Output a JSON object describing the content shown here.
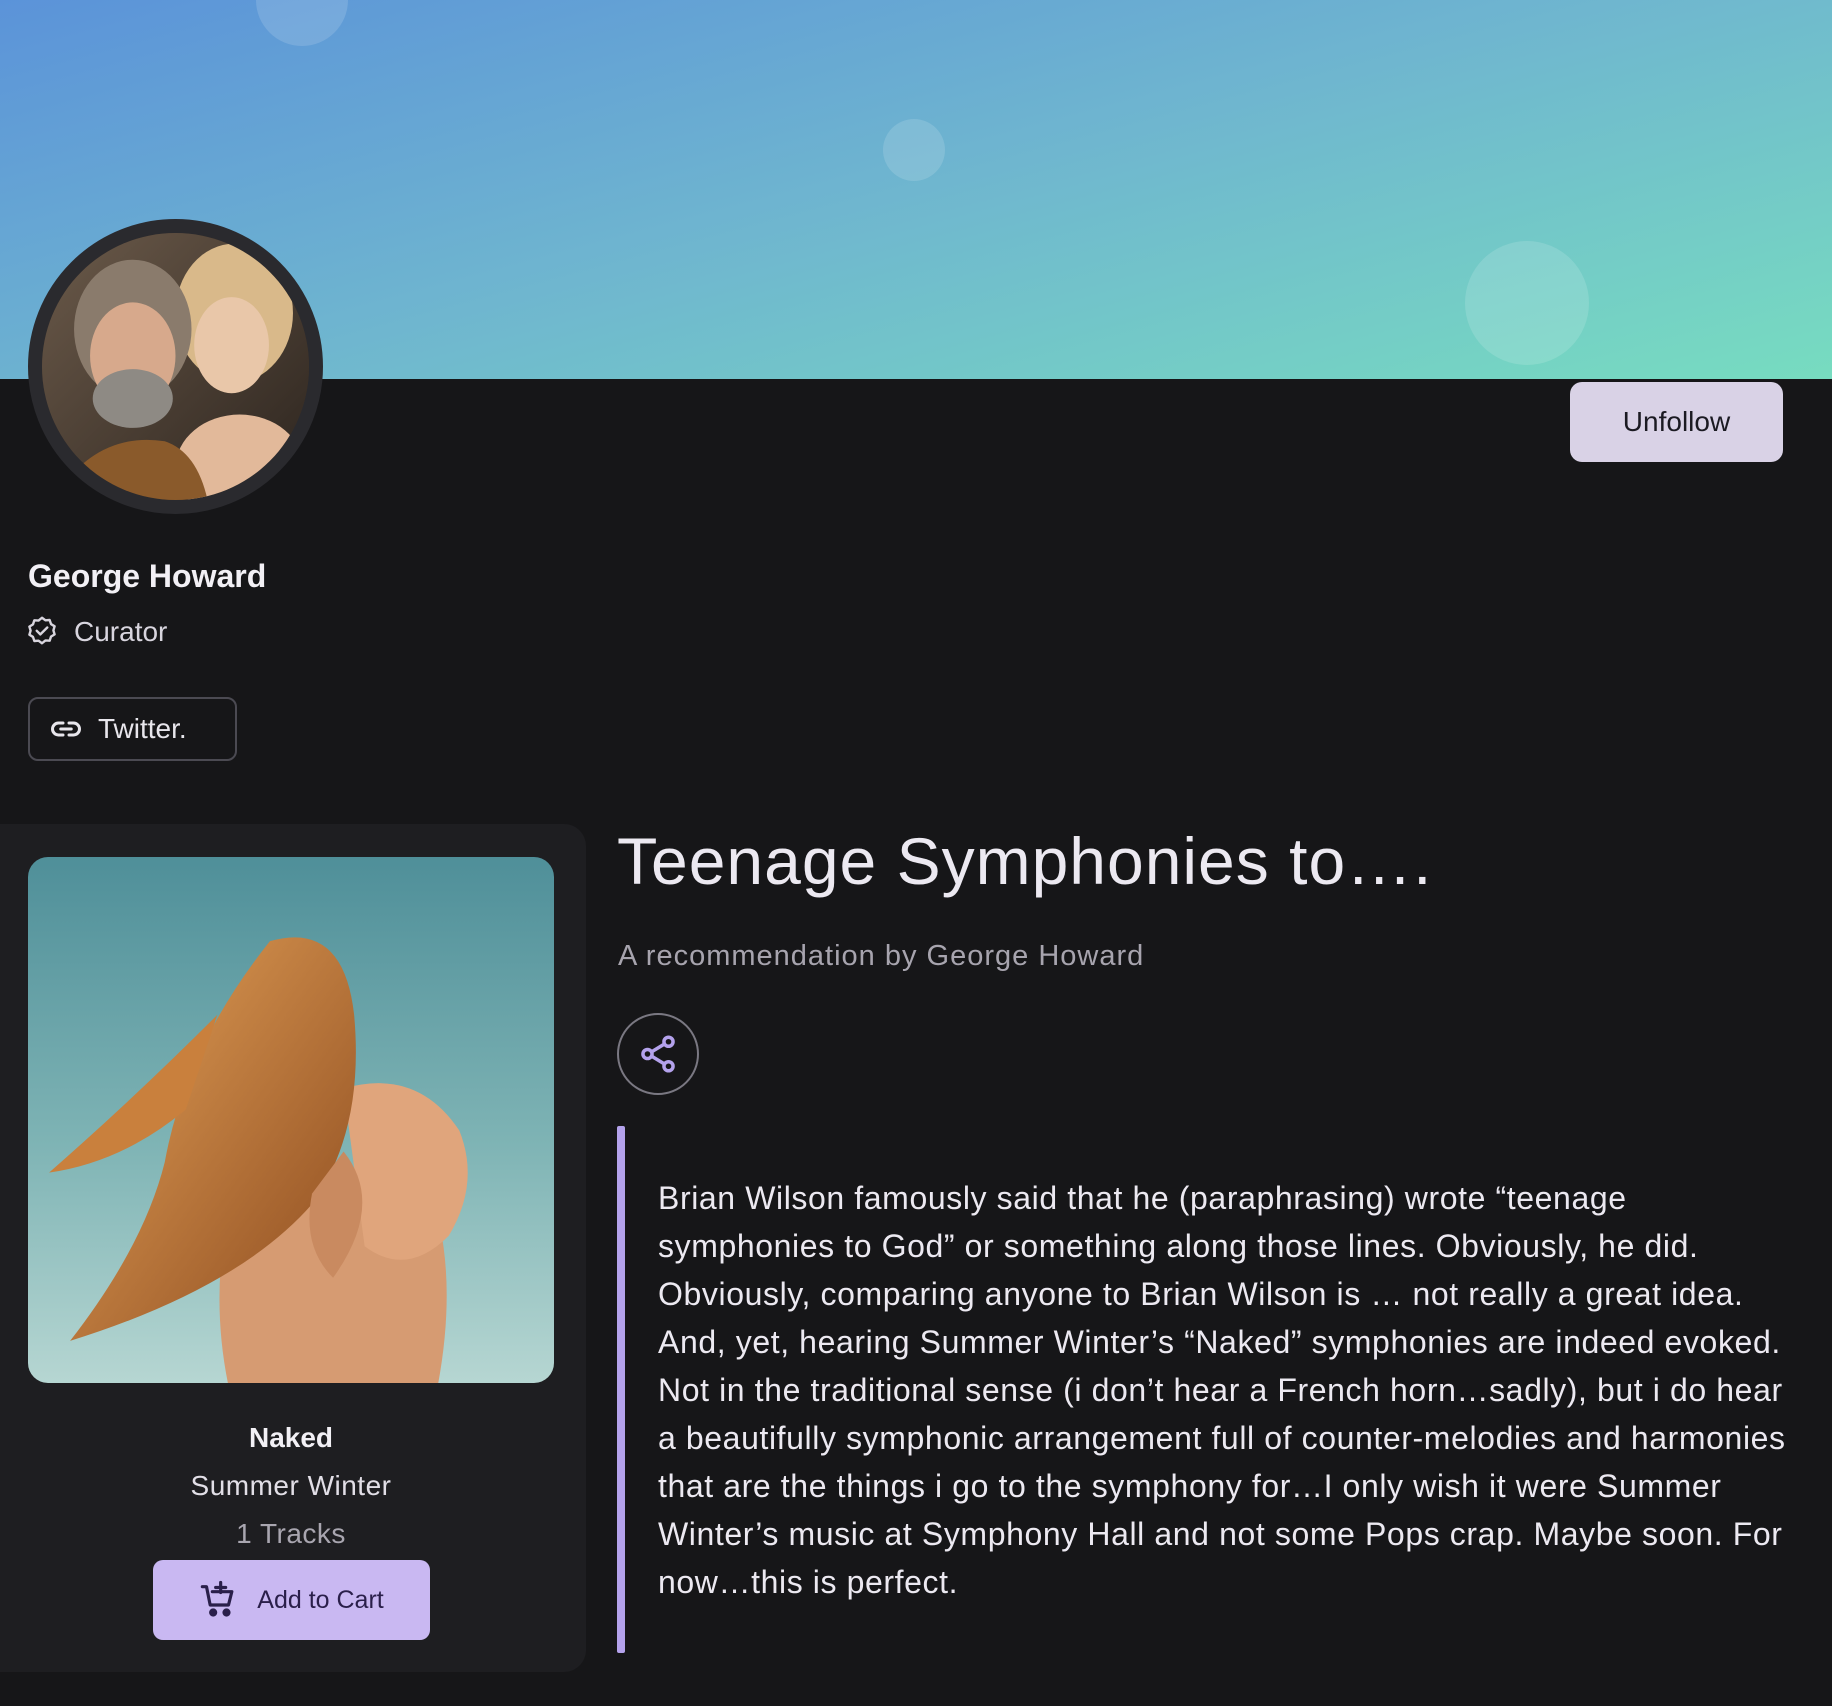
{
  "profile": {
    "name": "George Howard",
    "role": "Curator",
    "link_label": "Twitter.",
    "follow_button_label": "Unfollow"
  },
  "album": {
    "title": "Naked",
    "artist": "Summer Winter",
    "tracks": "1 Tracks",
    "cart_button_label": "Add to Cart"
  },
  "recommendation": {
    "title": "Teenage Symphonies to….",
    "byline": "A recommendation by George Howard",
    "body": "Brian Wilson famously said that he (paraphrasing) wrote “teenage symphonies to God” or something along those lines. Obviously, he did. Obviously, comparing anyone to Brian Wilson is … not really a great idea. And, yet, hearing Summer Winter’s “Naked” symphonies are indeed evoked. Not in the traditional sense (i don’t hear a French horn…sadly), but i do hear a beautifully symphonic arrangement full of counter-melodies and harmonies that are the things i go to the symphony for…I only wish it were Summer Winter’s music at Symphony Hall and not some Pops crap. Maybe soon. For now…this is perfect."
  },
  "icons": {
    "role": "verified-badge-icon",
    "link": "link-icon",
    "share": "share-icon",
    "cart": "cart-plus-icon"
  },
  "colors": {
    "background": "#161618",
    "accent": "#c9b8f2",
    "quote_bar": "#b4a2ec",
    "follow_button": "#d9d2e6",
    "banner_start": "#5b93d9",
    "banner_end": "#77dcc0"
  }
}
